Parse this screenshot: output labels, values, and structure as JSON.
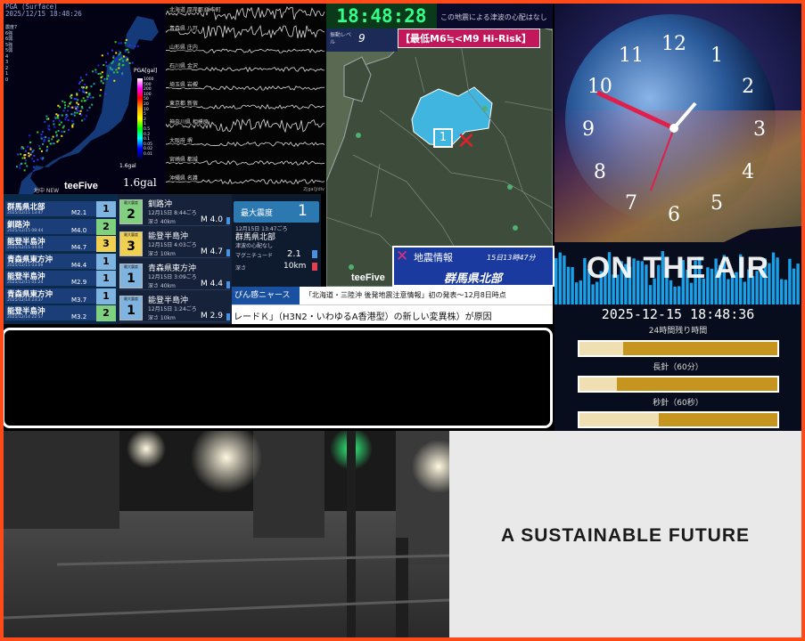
{
  "pga": {
    "title": "PGA (Surface)",
    "datetime": "2025/12/15 18:48:26",
    "scale_title": "PGA[gal]",
    "scale_labels": [
      "1000",
      "500",
      "200",
      "100",
      "50",
      "20",
      "10",
      "5",
      "2",
      "1",
      "0.5",
      "0.2",
      "0.1",
      "0.05",
      "0.02",
      "0.01"
    ],
    "legend": [
      "震度7",
      "6強",
      "6弱",
      "5強",
      "5弱",
      "4",
      "3",
      "2",
      "1",
      "0"
    ],
    "gal_label": "1.6gal",
    "gal_caption": "1.6gal",
    "brand": "teeFive",
    "new_label": "地中 NEW",
    "map_caption": "震源\n(予想)"
  },
  "waves": {
    "stations": [
      "北海道 厚岸郡 浜中町",
      "青森県 八戸",
      "山形県 庄内",
      "石川県 金沢",
      "埼玉県 岩槻",
      "東京都 新宿",
      "神奈川県 相模原",
      "大阪府 堺",
      "宮崎県 都城",
      "沖縄県 名護"
    ],
    "amp_note": "2[gal]/div"
  },
  "quake_list": [
    {
      "name": "群馬県北部",
      "date": "2025/12/15 13:47",
      "mag": "M2.1",
      "shindo": "1",
      "color": "#7fb3e0"
    },
    {
      "name": "釧路沖",
      "date": "2025/12/15 08:44",
      "mag": "M4.0",
      "shindo": "2",
      "color": "#7fd07f"
    },
    {
      "name": "能登半島沖",
      "date": "2025/12/15 04:03",
      "mag": "M4.7",
      "shindo": "3",
      "color": "#f0d050"
    },
    {
      "name": "青森県東方沖",
      "date": "2025/12/15 03:09",
      "mag": "M4.4",
      "shindo": "1",
      "color": "#7fb3e0"
    },
    {
      "name": "能登半島沖",
      "date": "2025/12/15 01:24",
      "mag": "M2.9",
      "shindo": "1",
      "color": "#7fb3e0"
    },
    {
      "name": "青森県東方沖",
      "date": "2025/12/14 23:37",
      "mag": "M3.7",
      "shindo": "1",
      "color": "#7fb3e0"
    },
    {
      "name": "能登半島沖",
      "date": "2025/12/14 22:57",
      "mag": "M3.2",
      "shindo": "2",
      "color": "#7fd07f"
    }
  ],
  "quake_detail": [
    {
      "badge": "2",
      "badge_label": "最大震度",
      "name": "釧路沖",
      "date": "12月15日 8:44ごろ",
      "depth": "深さ 40km",
      "mag": "M 4.0",
      "color": "#7fd07f"
    },
    {
      "badge": "3",
      "badge_label": "最大震度",
      "name": "能登半島沖",
      "date": "12月15日 4:03ごろ",
      "depth": "深さ 10km",
      "mag": "M 4.7",
      "color": "#f0d050"
    },
    {
      "badge": "1",
      "badge_label": "最大震度",
      "name": "青森県東方沖",
      "date": "12月15日 3:09ごろ",
      "depth": "深さ 40km",
      "mag": "M 4.4",
      "color": "#7fb3e0"
    },
    {
      "badge": "1",
      "badge_label": "最大震度",
      "name": "能登半島沖",
      "date": "12月15日 1:24ごろ",
      "depth": "深さ 10km",
      "mag": "M 2.9",
      "color": "#7fb3e0"
    }
  ],
  "intensity": {
    "label": "最大震度",
    "value": "1",
    "date": "12月15日 13:47ごろ",
    "area": "群馬県北部",
    "note": "津波の心配なし",
    "mag_label": "マグニチュード",
    "mag": "2.1",
    "depth_label": "深さ",
    "depth": "10km"
  },
  "ticker": {
    "tag": "ぴん感ニャース",
    "headline": "「北海道・三陸沖 後発地震注意情報」初の発表～12月8日時点",
    "scroll": "レードＫ」（H3N2・いわゆるA香港型）の新しい変異株）が原因"
  },
  "eew": {
    "time": "18:48:28",
    "tsunami": "この地震による津波の心配はなし",
    "level_label": "振動レベル",
    "level": "9",
    "risk": "【最低M6≒<M9 Hi-Risk】",
    "region_num": "1",
    "info_label": "地震情報",
    "info_time": "15日13時47分",
    "info_area": "群馬県北部",
    "brand": "teeFive"
  },
  "clock": {
    "numbers": [
      "12",
      "1",
      "2",
      "3",
      "4",
      "5",
      "6",
      "7",
      "8",
      "9",
      "10",
      "11"
    ]
  },
  "onair": {
    "title": "ON THE AIR",
    "datetime": "2025-12-15 18:48:36",
    "bars": [
      {
        "label": "24時間残り時間",
        "fraction": 0.22
      },
      {
        "label": "長針（60分）",
        "fraction": 0.19
      },
      {
        "label": "秒針（60秒）",
        "fraction": 0.4
      }
    ]
  },
  "future": {
    "text": "A SUSTAINABLE FUTURE"
  }
}
